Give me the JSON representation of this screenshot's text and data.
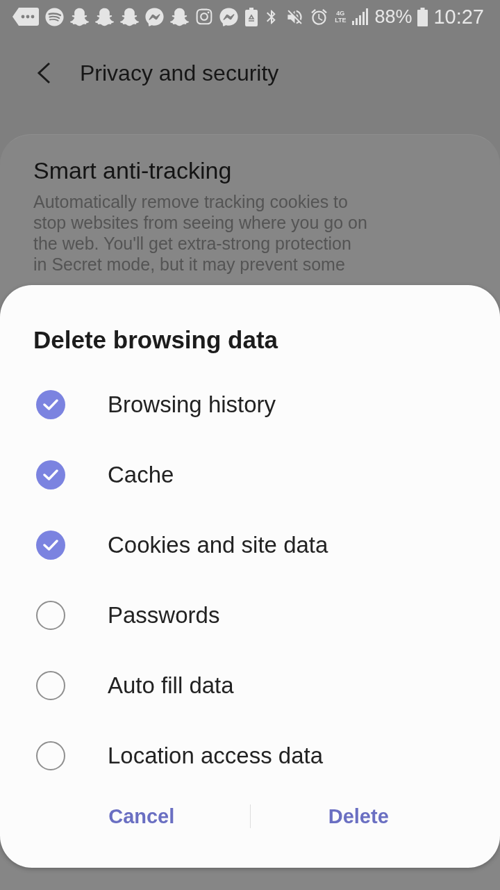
{
  "status_bar": {
    "network_type": "4G LTE",
    "battery": "88%",
    "time": "10:27"
  },
  "header": {
    "title": "Privacy and security"
  },
  "setting": {
    "title": "Smart anti-tracking",
    "description": "Automatically remove tracking cookies to stop websites from seeing where you go on the web. You'll get extra-strong protection in Secret mode, but it may prevent some"
  },
  "dialog": {
    "title": "Delete browsing data",
    "options": [
      {
        "label": "Browsing history",
        "checked": true
      },
      {
        "label": "Cache",
        "checked": true
      },
      {
        "label": "Cookies and site data",
        "checked": true
      },
      {
        "label": "Passwords",
        "checked": false
      },
      {
        "label": "Auto fill data",
        "checked": false
      },
      {
        "label": "Location access data",
        "checked": false
      }
    ],
    "buttons": [
      "Cancel",
      "Delete"
    ]
  }
}
